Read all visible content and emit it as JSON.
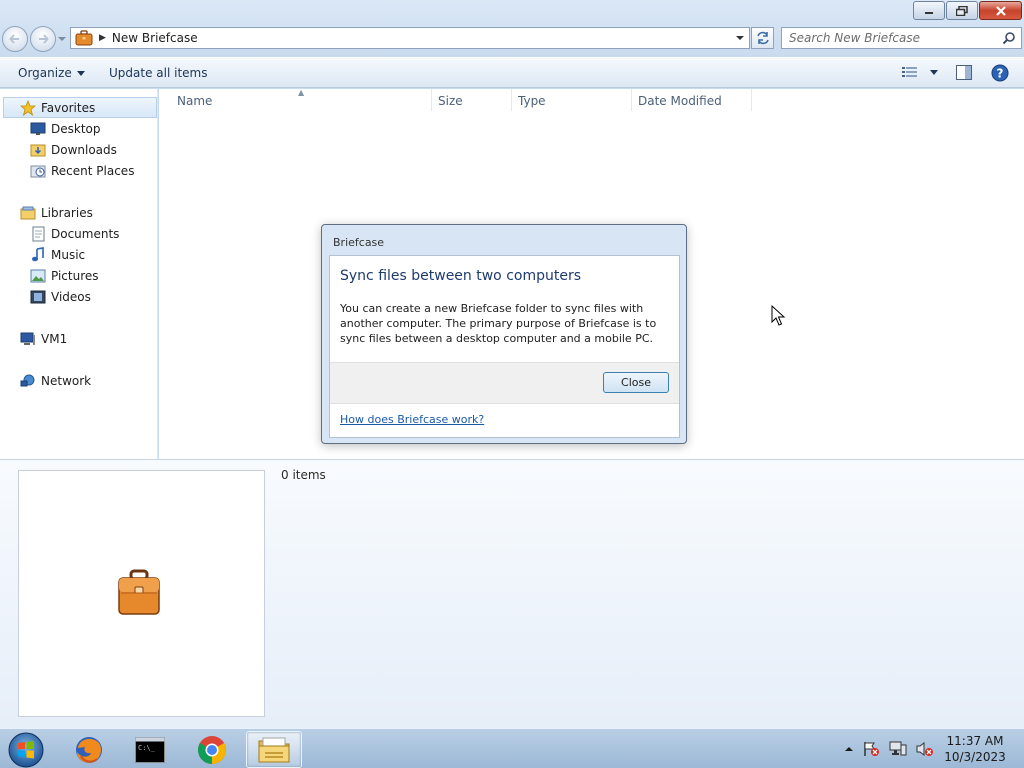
{
  "window": {
    "caption_buttons": [
      "minimize",
      "restore",
      "close"
    ]
  },
  "navbar": {
    "address_path": "New Briefcase",
    "search_placeholder": "Search New Briefcase"
  },
  "commandbar": {
    "organize_label": "Organize",
    "update_label": "Update all items"
  },
  "navpane": {
    "favorites_label": "Favorites",
    "favorites": [
      "Desktop",
      "Downloads",
      "Recent Places"
    ],
    "libraries_label": "Libraries",
    "libraries": [
      "Documents",
      "Music",
      "Pictures",
      "Videos"
    ],
    "computer_label": "VM1",
    "network_label": "Network"
  },
  "columns": {
    "name": "Name",
    "size": "Size",
    "type": "Type",
    "date": "Date Modified"
  },
  "details": {
    "item_count": "0 items"
  },
  "dialog": {
    "title": "Briefcase",
    "heading": "Sync files between two computers",
    "body": "You can create a new Briefcase folder to sync files with another computer. The primary purpose of Briefcase is to sync files between a desktop computer and a mobile PC.",
    "close_label": "Close",
    "help_link": "How does Briefcase work?"
  },
  "taskbar": {
    "apps": [
      "firefox",
      "command-prompt",
      "chrome",
      "windows-explorer"
    ],
    "active_app": "windows-explorer",
    "time": "11:37 AM",
    "date": "10/3/2023"
  }
}
